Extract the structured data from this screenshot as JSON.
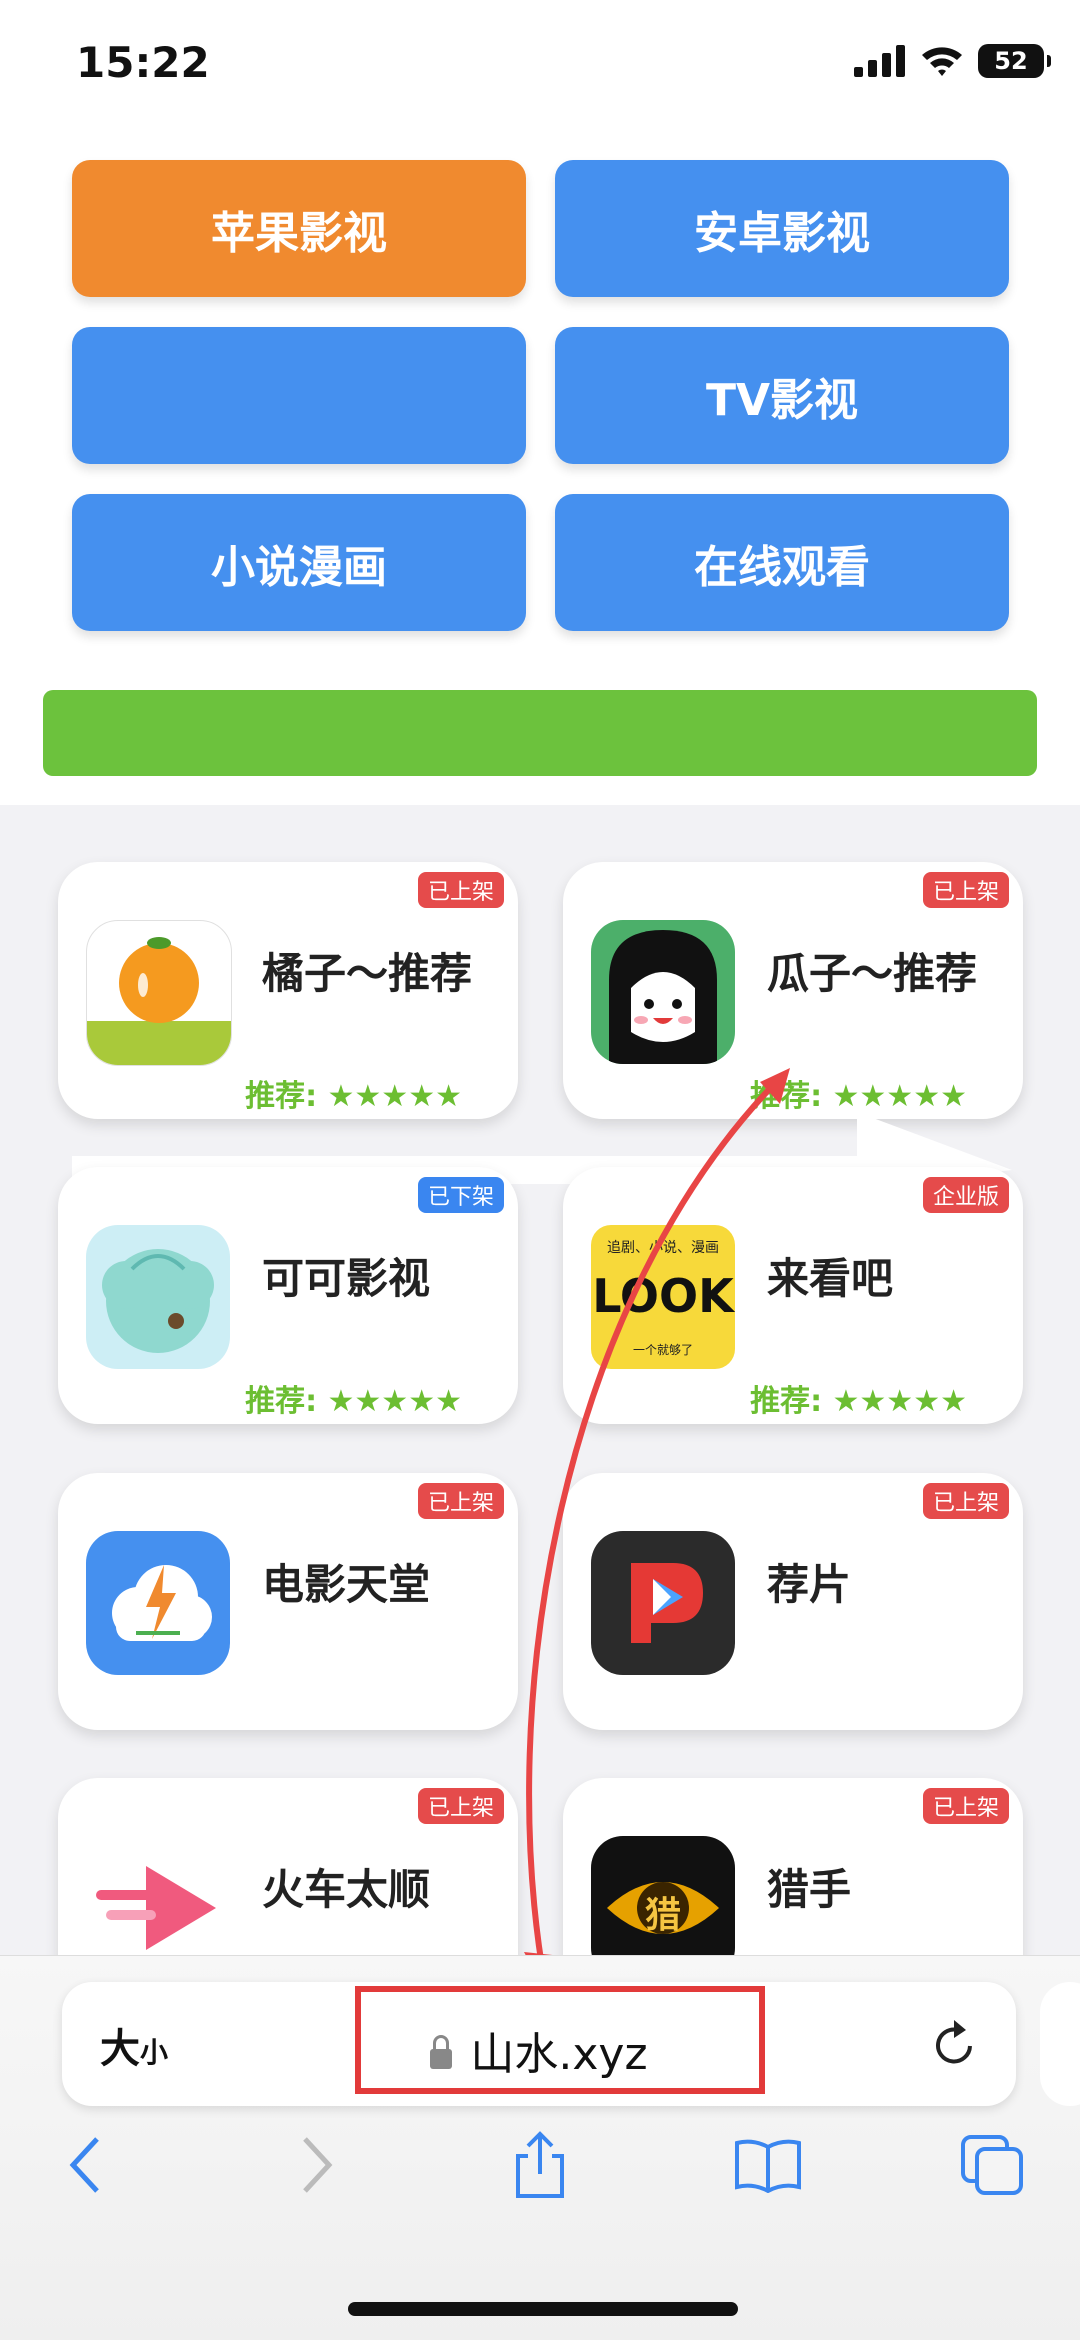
{
  "status": {
    "time": "15:22",
    "battery": "52"
  },
  "buttons": [
    "苹果影视",
    "安卓影视",
    "",
    "TV影视",
    "小说漫画",
    "在线观看"
  ],
  "apps": [
    {
      "title": "橘子～推荐",
      "badge": "已上架",
      "rating": "推荐: ★★★★★"
    },
    {
      "title": "瓜子～推荐",
      "badge": "已上架",
      "rating": "推荐: ★★★★★"
    },
    {
      "title": "可可影视",
      "badge": "已下架",
      "rating": "推荐: ★★★★★"
    },
    {
      "title": "来看吧",
      "badge": "企业版",
      "rating": "推荐: ★★★★★"
    },
    {
      "title": "电影天堂",
      "badge": "已上架",
      "rating": ""
    },
    {
      "title": "荐片",
      "badge": "已上架",
      "rating": ""
    },
    {
      "title": "火车太顺",
      "badge": "已上架",
      "rating": ""
    },
    {
      "title": "猎手",
      "badge": "已上架",
      "rating": ""
    }
  ],
  "icons": {
    "look_text": "LOOK",
    "look_top": "追剧、小说、漫画",
    "look_bottom": "一个就够了",
    "lieshou_glyph": "猎"
  },
  "browser": {
    "size_label_big": "大",
    "size_label_small": "小",
    "url": "山水.xyz"
  },
  "colors": {
    "orange": "#f08a2f",
    "blue": "#4590ef",
    "green": "#6cc23d",
    "red": "#e23a3a"
  }
}
